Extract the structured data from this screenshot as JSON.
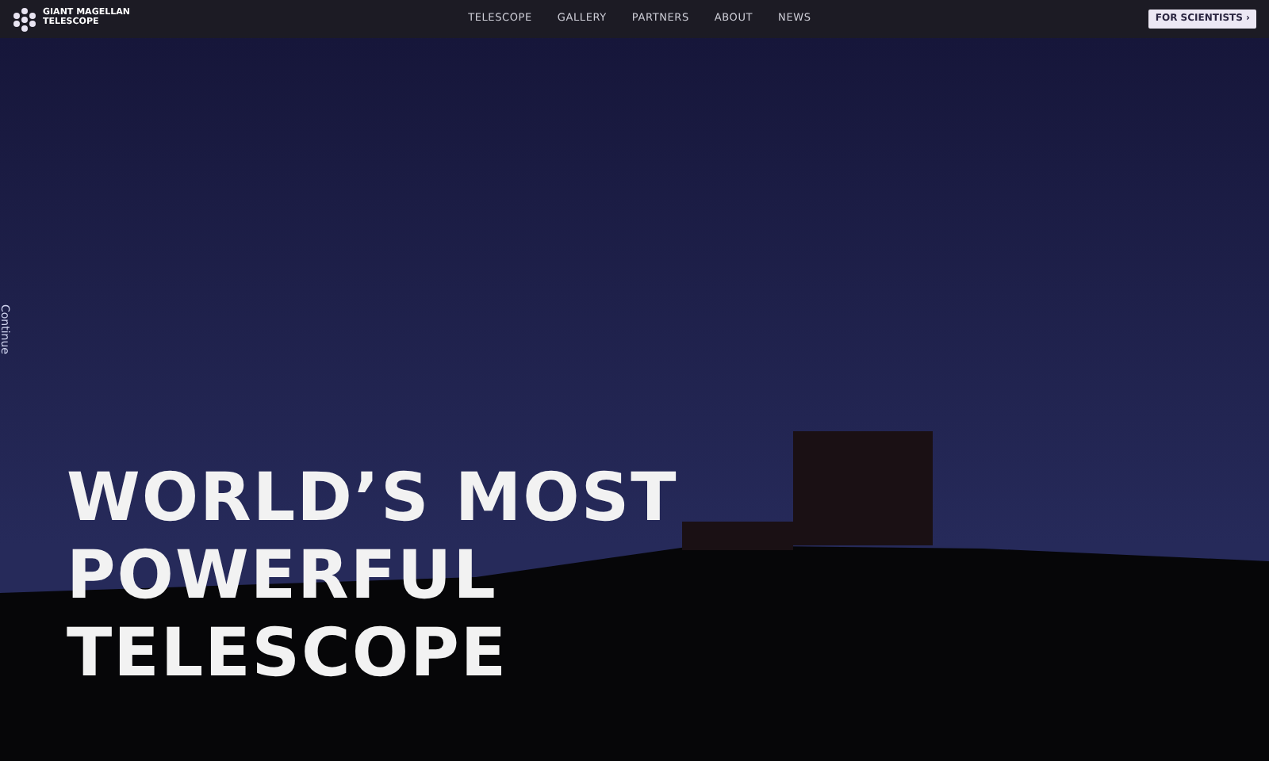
{
  "header": {
    "logo_text": [
      "GIANT MAGELLAN",
      "TELESCOPE"
    ],
    "nav": [
      {
        "label": "TELESCOPE"
      },
      {
        "label": "GALLERY"
      },
      {
        "label": "PARTNERS"
      },
      {
        "label": "ABOUT"
      },
      {
        "label": "NEWS"
      }
    ],
    "cta": {
      "label": "FOR SCIENTISTS",
      "icon": "›"
    }
  },
  "hero": {
    "side_label": "Continue",
    "heading": [
      "WORLD’S MOST",
      "POWERFUL",
      "TELESCOPE"
    ]
  }
}
